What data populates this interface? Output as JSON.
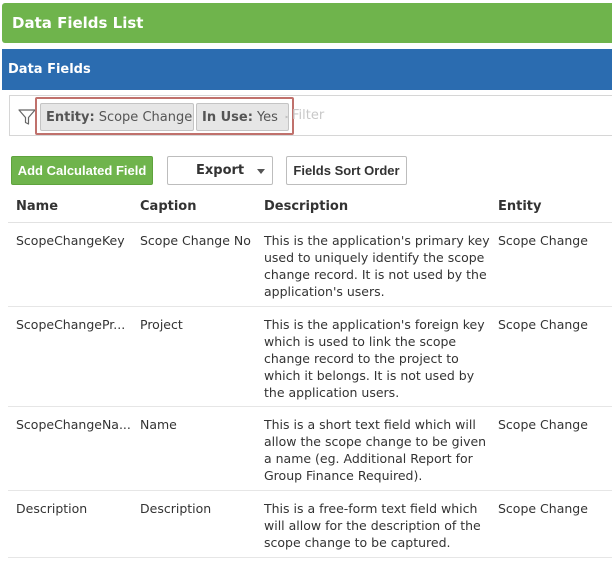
{
  "header": {
    "title": "Data Fields List"
  },
  "section": {
    "title": "Data Fields"
  },
  "filter": {
    "chips": [
      {
        "key": "Entity:",
        "value": "Scope Change"
      },
      {
        "key": "In Use:",
        "value": "Yes"
      }
    ],
    "placeholder": "Filter"
  },
  "toolbar": {
    "add_label": "Add Calculated Field",
    "export_label": "Export",
    "sort_label": "Fields Sort Order"
  },
  "table": {
    "columns": [
      "Name",
      "Caption",
      "Description",
      "Entity"
    ],
    "rows": [
      {
        "name": "ScopeChangeKey",
        "caption": "Scope Change No",
        "description": "This is the application's primary key used to uniquely identify the scope change record. It is not used by the application's users.",
        "entity": "Scope Change"
      },
      {
        "name": "ScopeChangePr...",
        "caption": "Project",
        "description": "This is the application's foreign key which is used to link the scope change record to the project to which it belongs. It is not used by the application users.",
        "entity": "Scope Change"
      },
      {
        "name": "ScopeChangeNa...",
        "caption": "Name",
        "description": "This is a short text field which will allow the scope change to be given a name (eg. Additional Report for Group Finance Required).",
        "entity": "Scope Change"
      },
      {
        "name": "Description",
        "caption": "Description",
        "description": "This is a free-form text field which will allow for the description of the scope change to be captured.",
        "entity": "Scope Change"
      }
    ]
  },
  "colors": {
    "green": "#6fb44c",
    "blue": "#2b6cb0",
    "highlight_border": "#c0716c"
  }
}
